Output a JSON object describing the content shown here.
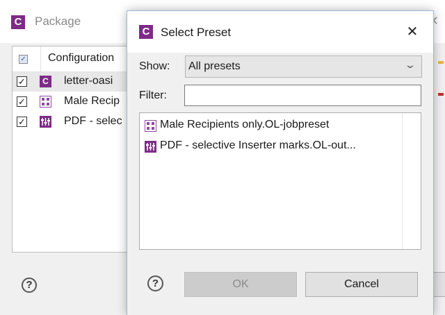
{
  "package_window": {
    "title": "Package",
    "app_icon_letter": "C",
    "close_glyph": "✕",
    "table": {
      "header": "Configuration",
      "rows": [
        {
          "label": "letter-oasi",
          "checked": true,
          "icon": "c-app-icon",
          "selected": true
        },
        {
          "label": "Male Recip",
          "checked": true,
          "icon": "job-preset-icon",
          "selected": false
        },
        {
          "label": "PDF - selec",
          "checked": true,
          "icon": "output-preset-icon",
          "selected": false
        }
      ]
    },
    "help_glyph": "?"
  },
  "dialog": {
    "title": "Select Preset",
    "app_icon_letter": "C",
    "close_glyph": "✕",
    "show_label": "Show:",
    "show_value": "All presets",
    "chevron_glyph": "⌄",
    "filter_label": "Filter:",
    "filter_value": "",
    "list_items": [
      {
        "label": "Male Recipients only.OL-jobpreset",
        "icon": "job-preset-icon"
      },
      {
        "label": "PDF - selective Inserter marks.OL-out...",
        "icon": "output-preset-icon"
      }
    ],
    "help_glyph": "?",
    "ok_label": "OK",
    "cancel_label": "Cancel"
  },
  "colors": {
    "brand": "#7d2b86",
    "job_icon": "#8e4aa0",
    "output_icon": "#7d2b86"
  }
}
